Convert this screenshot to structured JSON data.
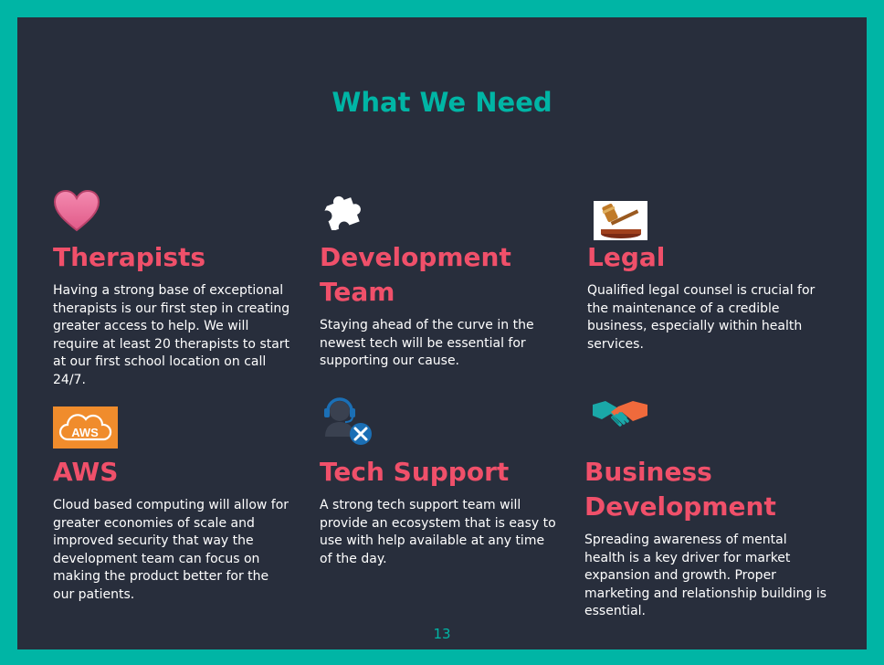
{
  "slide": {
    "title": "What We Need",
    "page_number": "13"
  },
  "colors": {
    "frame": "#00b5a5",
    "background": "#282e3c",
    "heading": "#f0506a",
    "title": "#00b5a5"
  },
  "cards": [
    {
      "icon": "heart-icon",
      "heading": "Therapists",
      "body": "Having a strong base of exceptional therapists is our first step in creating greater access to help. We will require at least 20 therapists to start at our first school location on call 24/7."
    },
    {
      "icon": "puzzle-piece-icon",
      "heading": "Development Team",
      "body": "Staying ahead of the curve in the newest tech will be essential for supporting our cause."
    },
    {
      "icon": "gavel-icon",
      "heading": "Legal",
      "body": "Qualified legal counsel is crucial for the maintenance of a credible business, especially within health services."
    },
    {
      "icon": "aws-cloud-icon",
      "icon_text": "AWS",
      "heading": "AWS",
      "body": "Cloud based computing will allow for greater economies of scale and improved security  that way the development team can focus on making the product better for the our patients."
    },
    {
      "icon": "headset-support-icon",
      "heading": "Tech Support",
      "body": "A strong tech support team will provide an ecosystem that is easy to use with help available at any time of the day."
    },
    {
      "icon": "handshake-icon",
      "heading": "Business Development",
      "body": "Spreading awareness of mental health is a key driver for market expansion and growth. Proper marketing and relationship building is essential."
    }
  ]
}
